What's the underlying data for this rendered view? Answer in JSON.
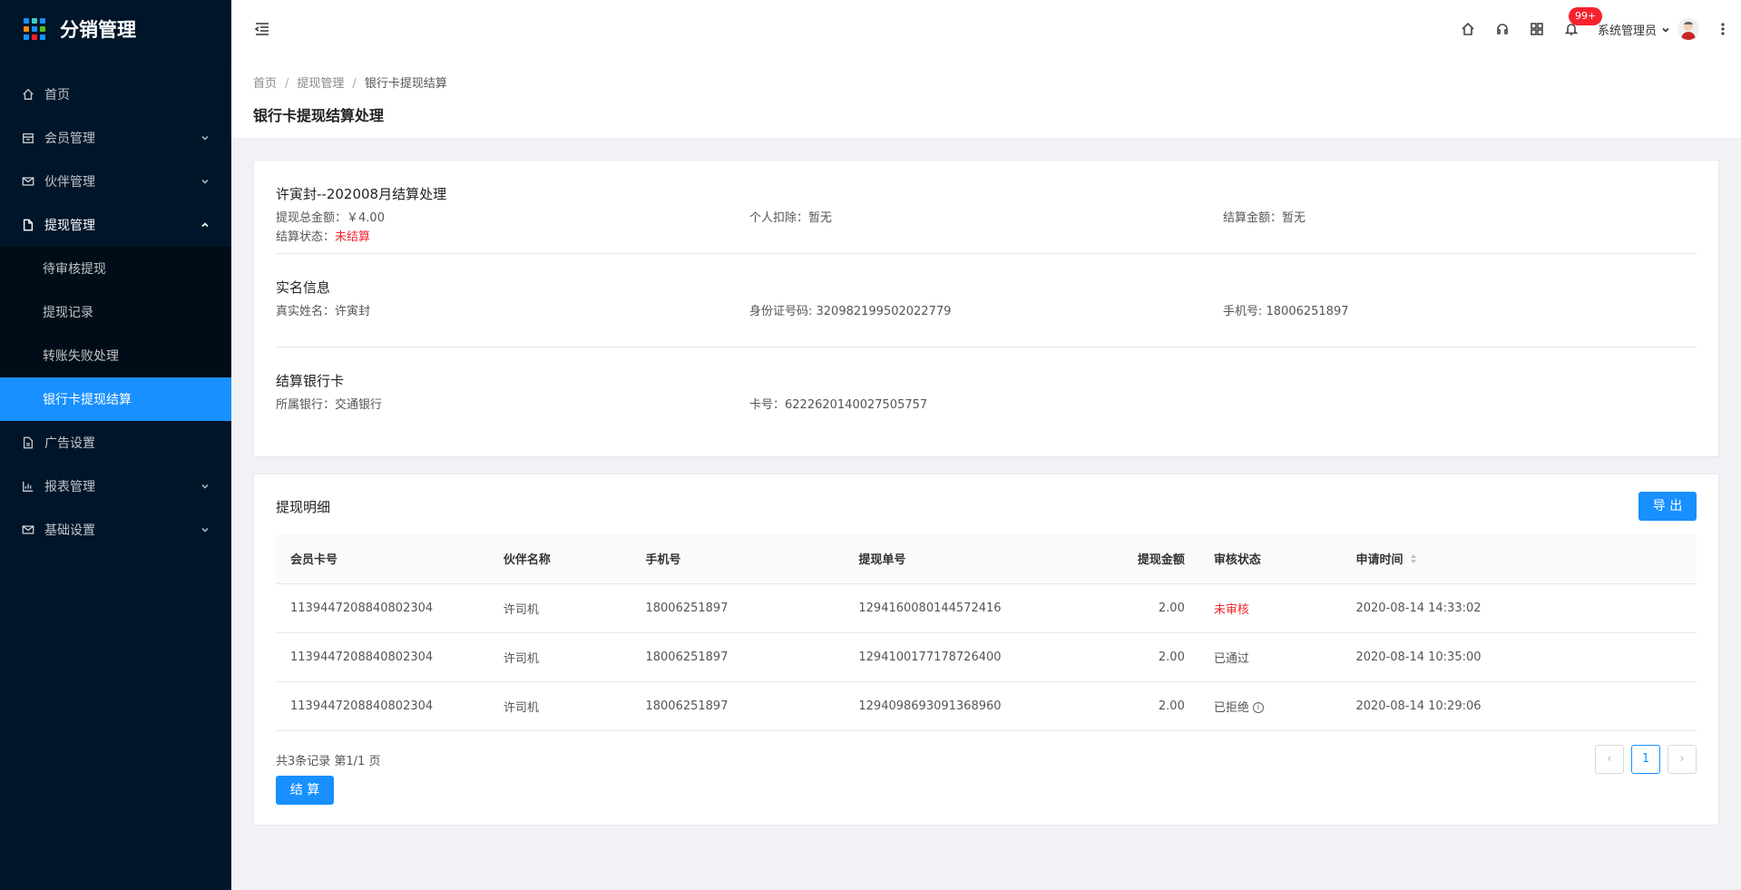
{
  "app": {
    "title": "分销管理"
  },
  "sidebar": {
    "items": [
      {
        "label": "首页"
      },
      {
        "label": "会员管理"
      },
      {
        "label": "伙伴管理"
      },
      {
        "label": "提现管理"
      },
      {
        "label": "广告设置"
      },
      {
        "label": "报表管理"
      },
      {
        "label": "基础设置"
      }
    ],
    "sub_items": [
      {
        "label": "待审核提现"
      },
      {
        "label": "提现记录"
      },
      {
        "label": "转账失败处理"
      },
      {
        "label": "银行卡提现结算"
      }
    ]
  },
  "header": {
    "notification_count": "99+",
    "user_name": "系统管理员"
  },
  "breadcrumb": [
    "首页",
    "提现管理",
    "银行卡提现结算"
  ],
  "page_title": "银行卡提现结算处理",
  "settlement": {
    "title": "许寅封--202008月结算处理",
    "total_label": "提现总金额：",
    "total_value": "￥4.00",
    "deduct_label": "个人扣除：",
    "deduct_value": "暂无",
    "settle_label": "结算金额：",
    "settle_value": "暂无",
    "status_label": "结算状态：",
    "status_value": "未结算"
  },
  "realname": {
    "title": "实名信息",
    "name_label": "真实姓名：",
    "name_value": "许寅封",
    "id_label": "身份证号码: ",
    "id_value": "320982199502022779",
    "phone_label": "手机号: ",
    "phone_value": "18006251897"
  },
  "bank": {
    "title": "结算银行卡",
    "bank_label": "所属银行：",
    "bank_value": "交通银行",
    "card_label": "卡号：",
    "card_value": "6222620140027505757"
  },
  "details": {
    "title": "提现明细",
    "export_label": "导 出",
    "columns": [
      "会员卡号",
      "伙伴名称",
      "手机号",
      "提现单号",
      "提现金额",
      "审核状态",
      "申请时间"
    ],
    "rows": [
      {
        "card": "1139447208840802304",
        "partner": "许司机",
        "phone": "18006251897",
        "order": "1294160080144572416",
        "amount": "2.00",
        "status": "未审核",
        "time": "2020-08-14 14:33:02"
      },
      {
        "card": "1139447208840802304",
        "partner": "许司机",
        "phone": "18006251897",
        "order": "1294100177178726400",
        "amount": "2.00",
        "status": "已通过",
        "time": "2020-08-14 10:35:00"
      },
      {
        "card": "1139447208840802304",
        "partner": "许司机",
        "phone": "18006251897",
        "order": "1294098693091368960",
        "amount": "2.00",
        "status": "已拒绝",
        "time": "2020-08-14 10:29:06"
      }
    ],
    "summary": "共3条记录 第1/1 页",
    "current_page": "1",
    "settle_label": "结 算"
  },
  "colors": {
    "primary": "#1890ff",
    "danger": "#f5222d",
    "sider": "#001529"
  }
}
